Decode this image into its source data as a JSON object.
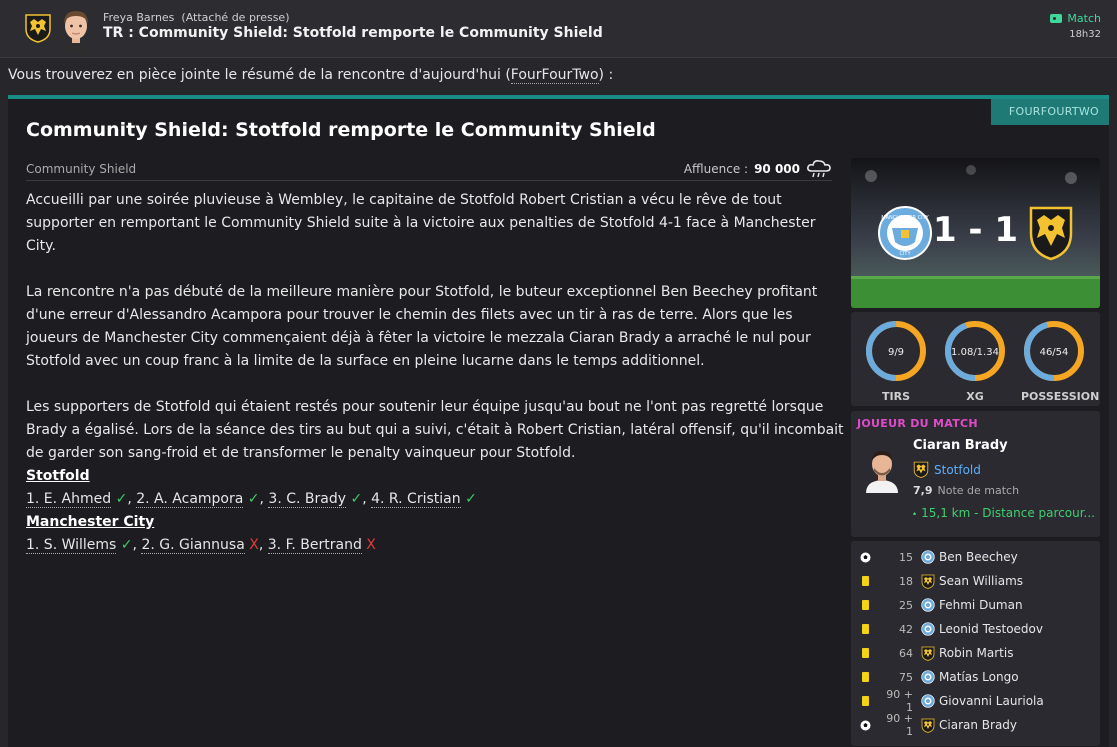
{
  "header": {
    "sender_name": "Freya Barnes",
    "sender_role": "(Attaché de presse)",
    "subject": "TR : Community Shield: Stotfold remporte le Community Shield",
    "tag": "Match",
    "time": "18h32"
  },
  "intro": {
    "text_before": "Vous trouverez en pièce jointe le résumé de la rencontre d'aujourd'hui (",
    "link": "FourFourTwo",
    "text_after": ") :"
  },
  "article": {
    "source": "FOURFOURTWO",
    "title": "Community Shield: Stotfold remporte le Community Shield",
    "competition": "Community Shield",
    "attendance_label": "Affluence :",
    "attendance_value": "90 000",
    "weather_icon": "rain-cloud-icon",
    "paragraph1": "Accueilli par une soirée pluvieuse à Wembley, le capitaine de Stotfold Robert Cristian a vécu le rêve de tout supporter en remportant le Community Shield suite à la victoire aux penalties de Stotfold 4-1 face à Manchester City.",
    "paragraph2": "La rencontre n'a pas débuté de la meilleure manière pour Stotfold, le buteur exceptionnel Ben Beechey profitant d'une erreur d'Alessandro Acampora pour trouver le chemin des filets avec un tir à ras de terre. Alors que les joueurs de Manchester City commençaient déjà à fêter la victoire le mezzala Ciaran Brady a arraché le nul pour Stotfold avec un coup franc à la limite de la surface en pleine lucarne dans le temps additionnel.",
    "paragraph3": "Les supporters de Stotfold qui étaient restés pour soutenir leur équipe jusqu'au bout ne l'ont pas regretté lorsque Brady a égalisé. Lors de la séance des tirs au but qui a suivi, c'était à Robert Cristian, latéral offensif, qu'il incombait de garder son sang-froid et de transformer le penalty vainqueur pour Stotfold."
  },
  "penalties": {
    "team1": "Stotfold",
    "team1_kicks": [
      {
        "label": "1. E. Ahmed",
        "result": "✓"
      },
      {
        "label": "2. A. Acampora",
        "result": "✓"
      },
      {
        "label": "3. C. Brady",
        "result": "✓"
      },
      {
        "label": "4. R. Cristian",
        "result": "✓"
      }
    ],
    "team2": "Manchester City",
    "team2_kicks": [
      {
        "label": "1. S. Willems",
        "result": "✓"
      },
      {
        "label": "2. G. Giannusa",
        "result": "X"
      },
      {
        "label": "3. F. Bertrand",
        "result": "X"
      }
    ]
  },
  "scoreboard": {
    "score": "1 - 1",
    "home_crest": "MANCHESTER CITY",
    "home_crest_sub": "CITY"
  },
  "stats": [
    {
      "label": "TIRS",
      "value": "9/9",
      "home": 9,
      "away": 9
    },
    {
      "label": "XG",
      "value": "1.08/1.34",
      "home": 1.08,
      "away": 1.34
    },
    {
      "label": "POSSESSION",
      "value": "46/54",
      "home": 46,
      "away": 54
    }
  ],
  "potm": {
    "heading": "JOUEUR DU MATCH",
    "name": "Ciaran Brady",
    "club": "Stotfold",
    "rating": "7,9",
    "rating_label": "Note de match",
    "distance": "15,1 km - Distance parcour..."
  },
  "events": [
    {
      "type": "goal",
      "minute": "15",
      "team": "city",
      "player": "Ben Beechey"
    },
    {
      "type": "yellow",
      "minute": "18",
      "team": "stotfold",
      "player": "Sean Williams"
    },
    {
      "type": "yellow",
      "minute": "25",
      "team": "city",
      "player": "Fehmi Duman"
    },
    {
      "type": "yellow",
      "minute": "42",
      "team": "city",
      "player": "Leonid Testoedov"
    },
    {
      "type": "yellow",
      "minute": "64",
      "team": "stotfold",
      "player": "Robin Martis"
    },
    {
      "type": "yellow",
      "minute": "75",
      "team": "city",
      "player": "Matías Longo"
    },
    {
      "type": "yellow",
      "minute": "90 + 1",
      "team": "city",
      "player": "Giovanni Lauriola"
    },
    {
      "type": "goal",
      "minute": "90 + 1",
      "team": "stotfold",
      "player": "Ciaran Brady"
    }
  ],
  "colors": {
    "accent_teal": "#1a8c86",
    "city_blue": "#6cabdd",
    "stotfold_gold": "#f2c230",
    "ring_orange": "#f5a623",
    "potm_pink": "#e04cc8",
    "positive_green": "#3fd06e"
  }
}
